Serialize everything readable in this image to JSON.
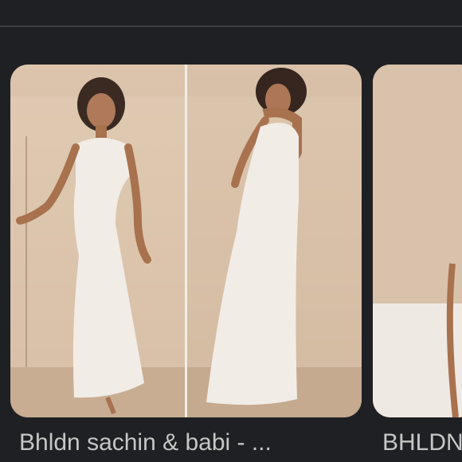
{
  "results": [
    {
      "caption": "Bhldn sachin & babi - ...",
      "image": "white sleeveless gown, front and back views"
    },
    {
      "caption": "BHLDN",
      "image": "white gown partially visible"
    }
  ],
  "colors": {
    "background": "#1f2023",
    "caption_text": "#c4c7c5",
    "divider": "#3c4043"
  }
}
